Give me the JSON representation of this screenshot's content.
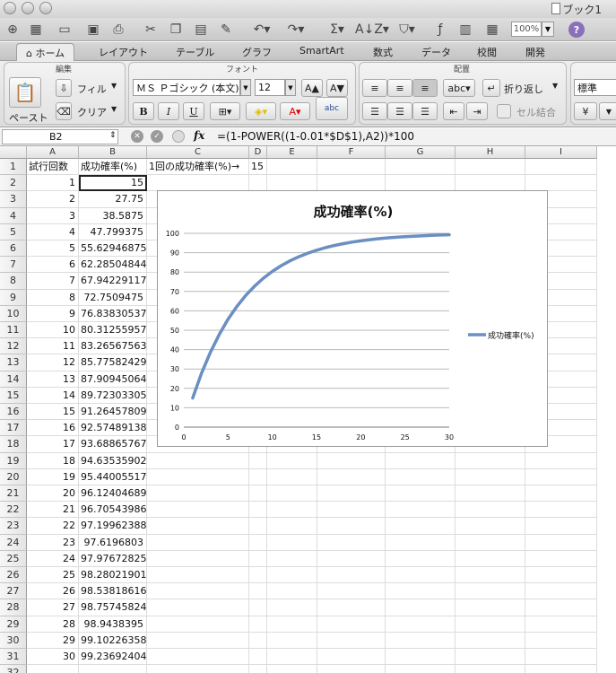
{
  "window": {
    "title": "ブック1"
  },
  "toolbar": {
    "zoom": "100%",
    "help": "?"
  },
  "ribbon_tabs": [
    "ホーム",
    "レイアウト",
    "テーブル",
    "グラフ",
    "SmartArt",
    "数式",
    "データ",
    "校閲",
    "開発"
  ],
  "ribbon": {
    "edit_group": "編集",
    "font_group": "フォント",
    "align_group": "配置",
    "paste": "ペースト",
    "fill": "フィル",
    "clear": "クリア",
    "font_name": "ＭＳ Ｐゴシック (本文)",
    "font_size": "12",
    "bold": "B",
    "italic": "I",
    "underline": "U",
    "abc": "abc",
    "wrap": "折り返し",
    "merge": "セル結合",
    "number_format": "標準"
  },
  "formula_bar": {
    "cell_ref": "B2",
    "fx": "fx",
    "formula": "=(1-POWER((1-0.01*$D$1),A2))*100"
  },
  "grid": {
    "columns": [
      "A",
      "B",
      "C",
      "D",
      "E",
      "F",
      "G",
      "H",
      "I"
    ],
    "a1": "試行回数",
    "b1": "成功確率(%)",
    "c1": "1回の成功確率(%)→",
    "d1": "15",
    "rows": [
      [
        "1",
        "15"
      ],
      [
        "2",
        "27.75"
      ],
      [
        "3",
        "38.5875"
      ],
      [
        "4",
        "47.799375"
      ],
      [
        "5",
        "55.62946875"
      ],
      [
        "6",
        "62.28504844"
      ],
      [
        "7",
        "67.94229117"
      ],
      [
        "8",
        "72.7509475"
      ],
      [
        "9",
        "76.83830537"
      ],
      [
        "10",
        "80.31255957"
      ],
      [
        "11",
        "83.26567563"
      ],
      [
        "12",
        "85.77582429"
      ],
      [
        "13",
        "87.90945064"
      ],
      [
        "14",
        "89.72303305"
      ],
      [
        "15",
        "91.26457809"
      ],
      [
        "16",
        "92.57489138"
      ],
      [
        "17",
        "93.68865767"
      ],
      [
        "18",
        "94.63535902"
      ],
      [
        "19",
        "95.44005517"
      ],
      [
        "20",
        "96.12404689"
      ],
      [
        "21",
        "96.70543986"
      ],
      [
        "22",
        "97.19962388"
      ],
      [
        "23",
        "97.6196803"
      ],
      [
        "24",
        "97.97672825"
      ],
      [
        "25",
        "98.28021901"
      ],
      [
        "26",
        "98.53818616"
      ],
      [
        "27",
        "98.75745824"
      ],
      [
        "28",
        "98.9438395"
      ],
      [
        "29",
        "99.10226358"
      ],
      [
        "30",
        "99.23692404"
      ]
    ]
  },
  "chart_data": {
    "type": "line",
    "title": "成功確率(%)",
    "xlabel": "",
    "ylabel": "",
    "xlim": [
      0,
      30
    ],
    "ylim": [
      0,
      100
    ],
    "xticks": [
      0,
      5,
      10,
      15,
      20,
      25,
      30
    ],
    "yticks": [
      0,
      10,
      20,
      30,
      40,
      50,
      60,
      70,
      80,
      90,
      100
    ],
    "grid": true,
    "legend": "right",
    "color": "#6a8fc2",
    "series": [
      {
        "name": "成功確率(%)",
        "x": [
          1,
          2,
          3,
          4,
          5,
          6,
          7,
          8,
          9,
          10,
          11,
          12,
          13,
          14,
          15,
          16,
          17,
          18,
          19,
          20,
          21,
          22,
          23,
          24,
          25,
          26,
          27,
          28,
          29,
          30
        ],
        "values": [
          15,
          27.75,
          38.5875,
          47.799375,
          55.62946875,
          62.28504844,
          67.94229117,
          72.7509475,
          76.83830537,
          80.31255957,
          83.26567563,
          85.77582429,
          87.90945064,
          89.72303305,
          91.26457809,
          92.57489138,
          93.68865767,
          94.63535902,
          95.44005517,
          96.12404689,
          96.70543986,
          97.19962388,
          97.6196803,
          97.97672825,
          98.28021901,
          98.53818616,
          98.75745824,
          98.9438395,
          99.10226358,
          99.23692404
        ]
      }
    ]
  }
}
